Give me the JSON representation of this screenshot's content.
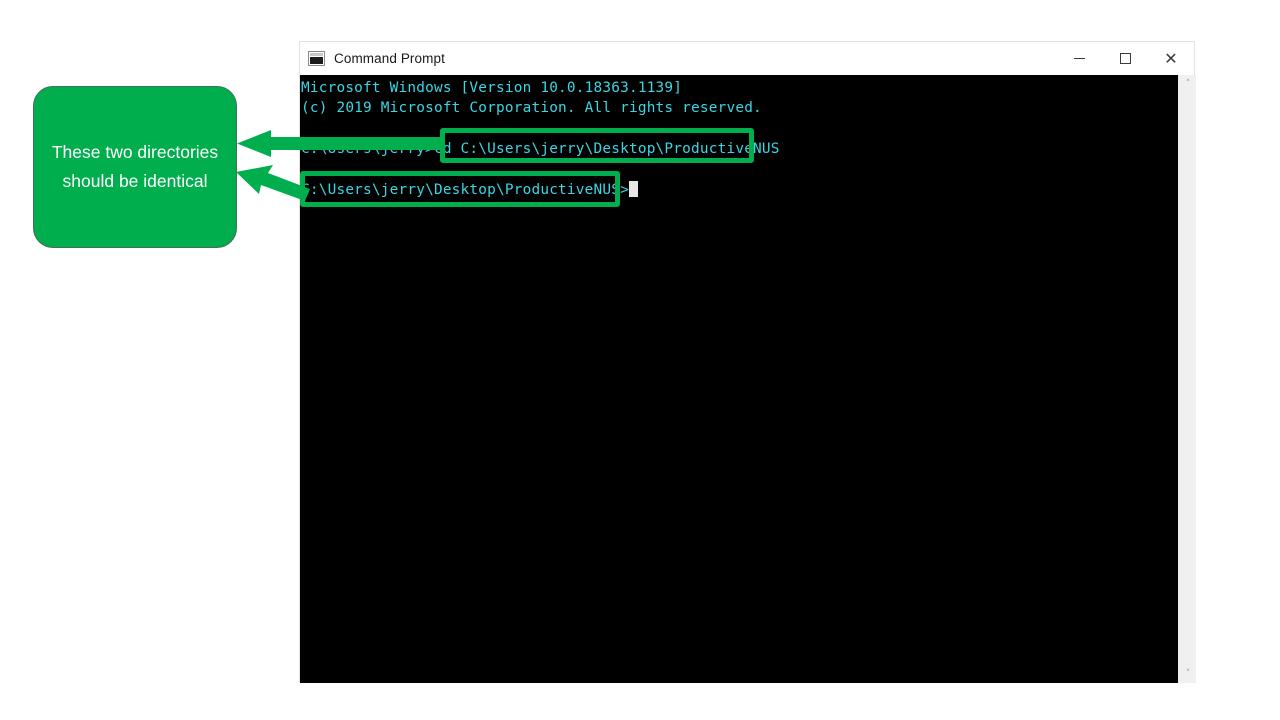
{
  "window": {
    "title": "Command Prompt",
    "icon": "cmd-console-icon",
    "controls": {
      "minimize_label": "–",
      "maximize_label": "□",
      "close_label": "✕"
    }
  },
  "console": {
    "background_color": "#000000",
    "text_color": "#3BD6E4",
    "lines": [
      "Microsoft Windows [Version 10.0.18363.1139]",
      "(c) 2019 Microsoft Corporation. All rights reserved.",
      "",
      "C:\\Users\\jerry>cd C:\\Users\\jerry\\Desktop\\ProductiveNUS",
      "",
      "C:\\Users\\jerry\\Desktop\\ProductiveNUS>"
    ],
    "command_typed": "cd C:\\Users\\jerry\\Desktop\\ProductiveNUS",
    "prompt_before": "C:\\Users\\jerry>",
    "prompt_after": "C:\\Users\\jerry\\Desktop\\ProductiveNUS>",
    "cursor": "block-cursor"
  },
  "scrollbar": {
    "up_arrow": "˄",
    "down_arrow": "˅"
  },
  "annotation": {
    "callout_text": "These two directories should be identical",
    "accent_color": "#00AE4D",
    "text_color": "#FFFFFF",
    "highlight_1_target": "C:\\Users\\jerry\\Desktop\\ProductiveNUS",
    "highlight_2_target": "C:\\Users\\jerry\\Desktop\\ProductiveNUS>"
  }
}
